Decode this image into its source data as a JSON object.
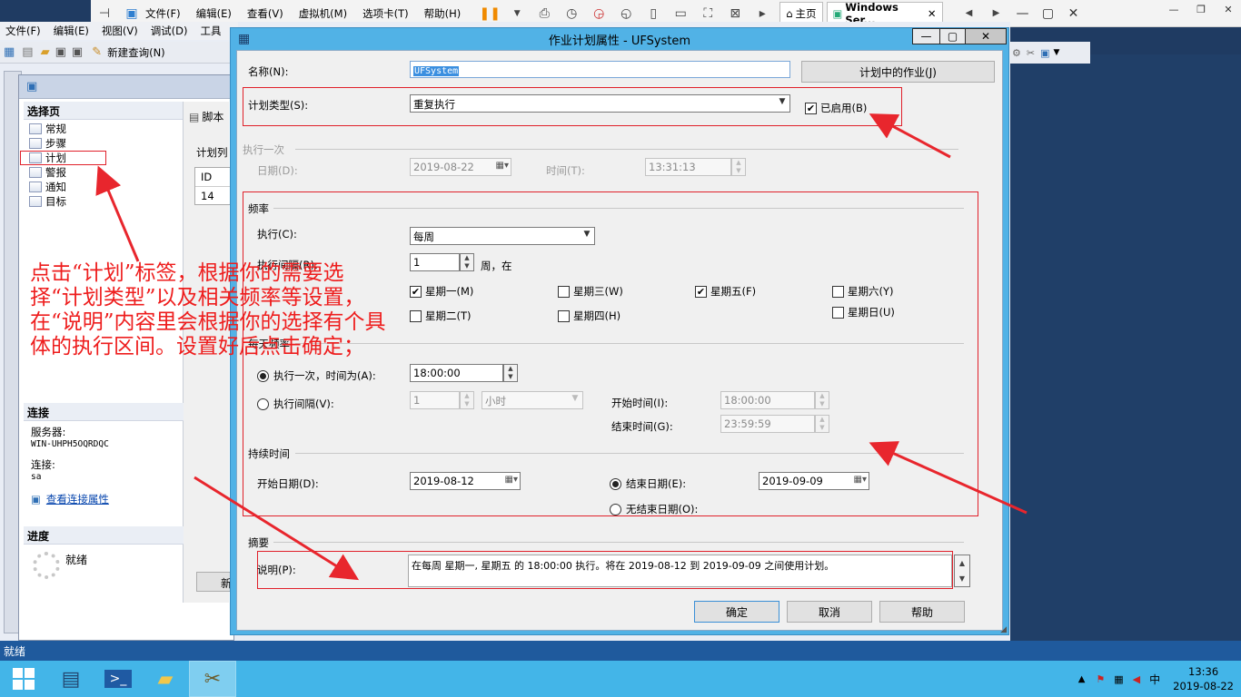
{
  "vmbar": {
    "menus": [
      "文件(F)",
      "编辑(E)",
      "查看(V)",
      "虚拟机(M)",
      "选项卡(T)",
      "帮助(H)"
    ],
    "tabs": [
      {
        "label": "主页"
      },
      {
        "label": "Windows Ser..."
      }
    ]
  },
  "ssms": {
    "menu": [
      "文件(F)",
      "编辑(E)",
      "视图(V)",
      "调试(D)",
      "工具"
    ],
    "new_query": "新建查询(N)"
  },
  "jobdlg": {
    "select_page": "选择页",
    "pages": [
      "常规",
      "步骤",
      "计划",
      "警报",
      "通知",
      "目标"
    ],
    "script": "脚本",
    "schedule_list": "计划列",
    "id_header": "ID",
    "id_value": "14",
    "new_btn": "新",
    "connection": "连接",
    "server_label": "服务器:",
    "server_value": "WIN-UHPH5OQRDQC",
    "conn_label": "连接:",
    "conn_value": "sa",
    "view_conn": "查看连接属性",
    "progress": "进度",
    "ready": "就绪"
  },
  "dialog": {
    "title": "作业计划属性 - UFSystem",
    "name_label": "名称(N):",
    "name_value": "UFSystem",
    "jobs_in_schedule": "计划中的作业(J)",
    "schedule_type_label": "计划类型(S):",
    "schedule_type_value": "重复执行",
    "enabled_label": "已启用(B)",
    "enabled": true,
    "once": {
      "header": "执行一次",
      "date_label": "日期(D):",
      "date_value": "2019-08-22",
      "time_label": "时间(T):",
      "time_value": "13:31:13"
    },
    "frequency": {
      "header": "频率",
      "occurs_label": "执行(C):",
      "occurs_value": "每周",
      "recurs_label": "执行间隔(R):",
      "recurs_value": "1",
      "recurs_unit": "周，在",
      "days": [
        {
          "label": "星期一(M)",
          "checked": true
        },
        {
          "label": "星期二(T)",
          "checked": false
        },
        {
          "label": "星期三(W)",
          "checked": false
        },
        {
          "label": "星期四(H)",
          "checked": false
        },
        {
          "label": "星期五(F)",
          "checked": true
        },
        {
          "label": "星期六(Y)",
          "checked": false
        },
        {
          "label": "星期日(U)",
          "checked": false
        }
      ]
    },
    "daily": {
      "header": "每天频率",
      "once_label": "执行一次，时间为(A):",
      "once_value": "18:00:00",
      "every_label": "执行间隔(V):",
      "every_value": "1",
      "every_unit": "小时",
      "start_label": "开始时间(I):",
      "start_value": "18:00:00",
      "end_label": "结束时间(G):",
      "end_value": "23:59:59"
    },
    "duration": {
      "header": "持续时间",
      "start_label": "开始日期(D):",
      "start_value": "2019-08-12",
      "end_label": "结束日期(E):",
      "end_value": "2019-09-09",
      "no_end_label": "无结束日期(O):"
    },
    "summary": {
      "header": "摘要",
      "desc_label": "说明(P):",
      "desc_value": "在每周 星期一, 星期五 的 18:00:00 执行。将在 2019-08-12 到 2019-09-09 之间使用计划。"
    },
    "ok": "确定",
    "cancel": "取消",
    "help": "帮助"
  },
  "annotation": "点击“计划”标签，根据你的需要选择“计划类型”以及相关频率等设置，在“说明”内容里会根据你的选择有个具体的执行区间。设置好后点击确定；",
  "status_text": "就绪",
  "clock": {
    "time": "13:36",
    "date": "2019-08-22"
  },
  "tray_ime": "中"
}
